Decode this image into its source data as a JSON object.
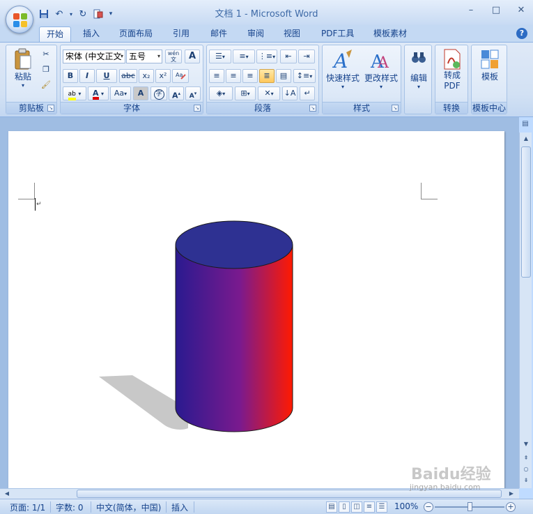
{
  "window": {
    "title": "文档 1 - Microsoft Word",
    "controls": [
      "–",
      "□",
      "✕"
    ]
  },
  "qat": {
    "icons": [
      "save-icon",
      "undo-icon",
      "redo-icon",
      "print-preview-icon"
    ],
    "customize": "▾"
  },
  "tabs": [
    "开始",
    "插入",
    "页面布局",
    "引用",
    "邮件",
    "审阅",
    "视图",
    "PDF工具",
    "模板素材"
  ],
  "active_tab": "开始",
  "ribbon": {
    "clipboard": {
      "label": "剪贴板",
      "paste": "粘贴"
    },
    "font": {
      "label": "字体",
      "font_name": "宋体 (中文正文",
      "font_size": "五号",
      "phonetic": "wén",
      "bold": "B",
      "italic": "I",
      "underline": "U",
      "strike": "abc",
      "subscript": "x₂",
      "superscript": "x²",
      "grow": "A",
      "shrink": "A",
      "change_case": "Aa",
      "char_shade": "A",
      "enclose": "字"
    },
    "paragraph": {
      "label": "段落"
    },
    "styles": {
      "label": "样式",
      "quick": "快速样式",
      "change": "更改样式"
    },
    "editing": {
      "label": "编辑"
    },
    "convert": {
      "label": "转换",
      "to_pdf_line1": "转成",
      "to_pdf_line2": "PDF"
    },
    "templates": {
      "label": "模板中心",
      "template": "模板"
    }
  },
  "document": {
    "shape": "cylinder",
    "colors": {
      "top": "#2e3192",
      "gradient_start": "#2a1a8f",
      "gradient_mid": "#7a1a8e",
      "gradient_end": "#ff1a00",
      "shadow": "#c8c8c8"
    }
  },
  "status": {
    "page": "页面: 1/1",
    "words": "字数: 0",
    "language": "中文(简体，中国)",
    "mode": "插入",
    "zoom": "100%"
  },
  "watermark": {
    "text": "Baidu经验",
    "url": "jingyan.baidu.com"
  },
  "colors": {
    "accent": "#15428b",
    "ribbon": "#d2e1f4",
    "highlight": "#ffc85c"
  }
}
